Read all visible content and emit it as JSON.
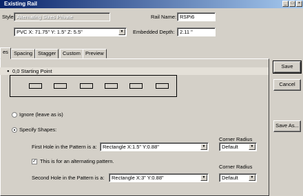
{
  "window": {
    "title": "Existing Rail"
  },
  "form": {
    "style_label": "Style:",
    "style_value": "Alternating Sizes Private",
    "rail_name_label": "Rail Name:",
    "rail_name_value": "RSPi6",
    "position_value": "PVC X: 71.75\" Y: 1.5\" Z: 5.5\"",
    "embedded_depth_label": "Embedded Depth:",
    "embedded_depth_value": "2.11 \""
  },
  "tabs": [
    "es",
    "Spacing",
    "Stagger",
    "Custom",
    "Preview"
  ],
  "active_tab": 0,
  "options": {
    "starting_point_label": "0,0 Starting Point",
    "ignore_label": "Ignore (leave as is)",
    "specify_label": "Specify Shapes:",
    "first_hole_label": "First Hole in the Pattern is a:",
    "first_hole_value": "Rectangle X:1.5\" Y:0.88\"",
    "corner_radius_label_1": "Corner Radius",
    "corner_radius_value_1": "Default",
    "alternating_label": "This is for an alternating pattern.",
    "second_hole_label": "Second Hole in the Pattern is a:",
    "second_hole_value": "Rectangle X:3\" Y:0.88\"",
    "corner_radius_label_2": "Corner Radius",
    "corner_radius_value_2": "Default",
    "ignore_selected": false,
    "specify_selected": true,
    "alternating_checked": true
  },
  "buttons": {
    "save": "Save",
    "cancel": "Cancel",
    "save_as": "Save As..."
  },
  "titlebar_buttons": {
    "minimize": "_",
    "maximize": "□",
    "close": "×"
  }
}
